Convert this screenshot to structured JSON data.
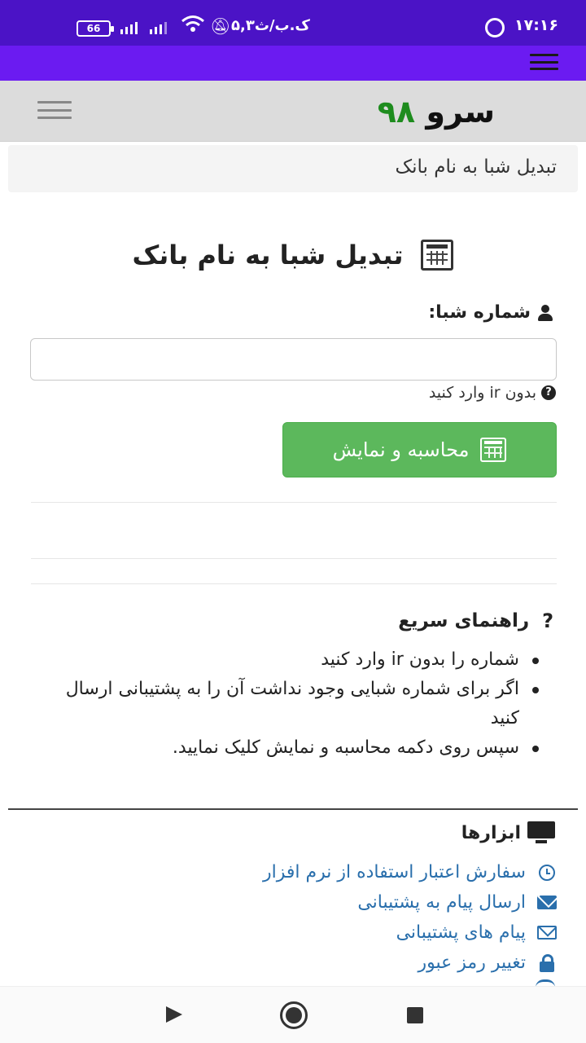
{
  "status_bar": {
    "time": "۱۷:۱۶",
    "carrier": "۵,۳ک.ب/ث",
    "battery": "66"
  },
  "header": {
    "logo_word1": "سرو",
    "logo_word2": "۹۸"
  },
  "breadcrumb": "تبدیل شبا به نام بانک",
  "page_title": "تبدیل شبا به نام بانک",
  "form": {
    "label": "شماره شبا:",
    "input_value": "",
    "hint": "بدون ir وارد کنید",
    "submit_label": "محاسبه و نمایش"
  },
  "guide": {
    "title": "راهنمای سریع",
    "items": [
      "شماره را بدون ir وارد کنید",
      "اگر برای شماره شبایی وجود نداشت آن را به پشتیبانی ارسال کنید",
      "سپس روی دکمه محاسبه و نمایش کلیک نمایید."
    ]
  },
  "tools": {
    "title": "ابزارها",
    "items": [
      {
        "label": "سفارش اعتبار استفاده از نرم افزار",
        "icon": "clock-icon"
      },
      {
        "label": "ارسال پیام به پشتیبانی",
        "icon": "envelope-icon"
      },
      {
        "label": "پیام های پشتیبانی",
        "icon": "envelope-outline-icon"
      },
      {
        "label": "تغییر رمز عبور",
        "icon": "lock-icon"
      }
    ]
  },
  "colors": {
    "status_bar": "#4b13c6",
    "app_bar": "#6b1bf1",
    "logo_accent": "#1e8c1e",
    "button": "#5cb85c",
    "link": "#2a6fac"
  }
}
